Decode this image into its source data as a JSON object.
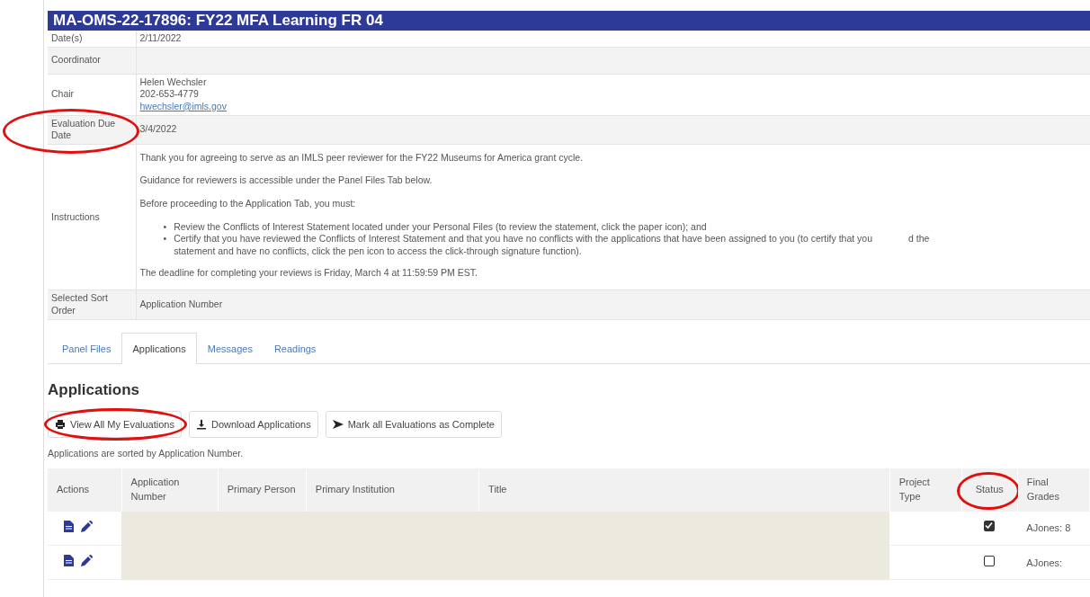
{
  "title": "MA-OMS-22-17896: FY22 MFA Learning FR 04",
  "details": [
    {
      "label": "Date(s)",
      "lines": [
        "2/11/2022"
      ],
      "highlighted": false
    },
    {
      "label": "Coordinator",
      "highlighted": false
    },
    {
      "label": "Chair",
      "lines": [
        "Helen Wechsler",
        "202-653-4779"
      ],
      "email": "hwechsler@imls.gov",
      "highlighted": false
    },
    {
      "label": "Evaluation Due Date",
      "lines": [
        "3/4/2022"
      ],
      "highlighted": true
    },
    {
      "label": "Instructions",
      "kind": "instructions",
      "paragraphs_before": [
        "Thank you for agreeing to serve as an IMLS peer reviewer for the FY22 Museums for America grant cycle.",
        "Guidance for reviewers is accessible under the Panel Files Tab below.",
        "Before proceeding to the Application Tab, you must:"
      ],
      "bullets": [
        {
          "marker": "•",
          "start": "Review the Conflicts of Interest Statement located under your Personal Files (to review the statement, click the paper icon); and"
        },
        {
          "marker": "•",
          "start": "Certify that you have reviewed the Conflicts of Interest Statement and that you have no conflicts with the applications that have been assigned to you (to certify that you",
          "end": "d the",
          "next": "statement and have no conflicts, click the pen icon to access the click-through signature function)."
        }
      ],
      "paragraph_after": "The deadline for completing your reviews is Friday, March 4 at 11:59:59 PM EST.",
      "highlighted": false
    },
    {
      "label": "Selected Sort Order",
      "lines": [
        "Application Number"
      ],
      "highlighted": false
    }
  ],
  "tabs": [
    {
      "label": "Panel Files",
      "selected": false
    },
    {
      "label": "Applications",
      "selected": true
    },
    {
      "label": "Messages",
      "selected": false
    },
    {
      "label": "Readings",
      "selected": false
    }
  ],
  "heading": "Applications",
  "buttons": [
    {
      "label": "View All My Evaluations",
      "highlighted": true
    },
    {
      "label": "Download Applications",
      "highlighted": false
    },
    {
      "label": "Mark all Evaluations as Complete",
      "highlighted": false
    }
  ],
  "sort_note": "Applications are sorted by Application Number.",
  "table": {
    "columns": [
      {
        "label": "Actions",
        "highlighted": false
      },
      {
        "label": "Application Number",
        "highlighted": false
      },
      {
        "label": "Primary Person",
        "highlighted": false
      },
      {
        "label": "Primary Institution",
        "highlighted": false
      },
      {
        "label": "Title",
        "highlighted": false
      },
      {
        "label": "Project Type",
        "highlighted": false
      },
      {
        "label": "Status",
        "highlighted": true
      },
      {
        "label": "Final Grades",
        "highlighted": false
      }
    ],
    "rows": [
      {
        "checked": true,
        "final_grades": "AJones: 8"
      },
      {
        "checked": false,
        "final_grades": "AJones:"
      }
    ]
  }
}
